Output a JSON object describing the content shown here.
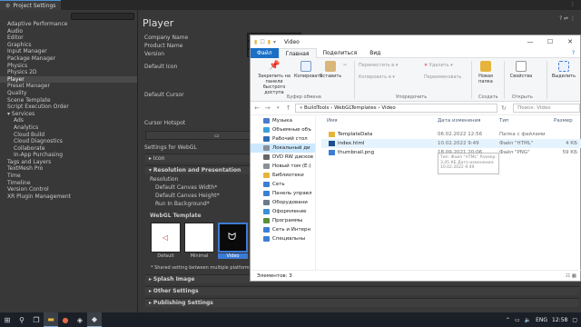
{
  "unity": {
    "window_tab": "Project Settings",
    "categories": [
      {
        "label": "Adaptive Performance"
      },
      {
        "label": "Audio"
      },
      {
        "label": "Editor"
      },
      {
        "label": "Graphics"
      },
      {
        "label": "Input Manager"
      },
      {
        "label": "Package Manager"
      },
      {
        "label": "Physics"
      },
      {
        "label": "Physics 2D"
      },
      {
        "label": "Player",
        "selected": true
      },
      {
        "label": "Preset Manager"
      },
      {
        "label": "Quality"
      },
      {
        "label": "Scene Template"
      },
      {
        "label": "Script Execution Order"
      },
      {
        "label": "▾ Services"
      },
      {
        "label": "Ads",
        "sub": true
      },
      {
        "label": "Analytics",
        "sub": true
      },
      {
        "label": "Cloud Build",
        "sub": true
      },
      {
        "label": "Cloud Diagnostics",
        "sub": true
      },
      {
        "label": "Collaborate",
        "sub": true
      },
      {
        "label": "In-App Purchasing",
        "sub": true
      },
      {
        "label": "Tags and Layers"
      },
      {
        "label": "TextMesh Pro"
      },
      {
        "label": "Time"
      },
      {
        "label": "Timeline"
      },
      {
        "label": "Version Control"
      },
      {
        "label": "XR Plugin Management"
      }
    ],
    "player": {
      "title": "Player",
      "company_name": "Company Name",
      "product_name": "Product Name",
      "version": "Version",
      "default_icon": "Default Icon",
      "default_cursor": "Default Cursor",
      "cursor_hotspot": "Cursor Hotspot",
      "settings_for": "Settings for WebGL",
      "icon_section": "Icon",
      "resolution_section": "Resolution and Presentation",
      "resolution_label": "Resolution",
      "canvas_width": "Default Canvas Width*",
      "canvas_height": "Default Canvas Height*",
      "run_in_background": "Run In Background*",
      "webgl_template": "WebGL Template",
      "templates": [
        {
          "label": "Default",
          "bg": "#ffffff"
        },
        {
          "label": "Minimal",
          "bg": "#ffffff"
        },
        {
          "label": "Video",
          "bg": "#0a0a0a"
        }
      ],
      "shared_note": "* Shared setting between multiple platforms.",
      "splash_section": "Splash Image",
      "other_section": "Other Settings",
      "publishing_section": "Publishing Settings"
    }
  },
  "explorer": {
    "title": "Video",
    "ribbon_tabs": [
      "Файл",
      "Главная",
      "Поделиться",
      "Вид"
    ],
    "ribbon": {
      "pin": "Закрепить на панели быстрого доступа",
      "copy": "Копировать",
      "paste": "Вставить",
      "clipboard_group": "Буфер обмена",
      "move_to": "Переместить в ▾",
      "copy_to": "Копировать в ▾",
      "delete": "Удалить ▾",
      "rename": "Переименовать",
      "organize_group": "Упорядочить",
      "new_folder": "Новая папка",
      "create_group": "Создать",
      "properties": "Свойства",
      "open_group": "Открыть",
      "select": "Выделить"
    },
    "address": "«  BuildTools  ›  WebGLTemplates  ›  Video",
    "search_placeholder": "Поиск: Video",
    "nav_items": [
      {
        "label": "Музыка",
        "color": "#4a7bd0"
      },
      {
        "label": "Объемные объ",
        "color": "#3aa0d8"
      },
      {
        "label": "Рабочий стол",
        "color": "#2d6db3"
      },
      {
        "label": "Локальный ди",
        "color": "#8a8f99",
        "selected": true
      },
      {
        "label": "DVD RW дисков",
        "color": "#666"
      },
      {
        "label": "Новый том (E:)",
        "color": "#8a8f99"
      },
      {
        "label": "Библиотеки",
        "color": "#e6b43c"
      },
      {
        "label": "Сеть",
        "color": "#3b7fd4"
      },
      {
        "label": "Панель управл",
        "color": "#3b7fd4"
      },
      {
        "label": "Оборудовани",
        "color": "#6b7a8c"
      },
      {
        "label": "Оформление",
        "color": "#3b8fd4"
      },
      {
        "label": "Программы",
        "color": "#5a8f3c"
      },
      {
        "label": "Сеть и Интерн",
        "color": "#3b7fd4"
      },
      {
        "label": "Специальны",
        "color": "#3b7fd4"
      }
    ],
    "columns": {
      "name": "Имя",
      "date": "Дата изменения",
      "type": "Тип",
      "size": "Размер"
    },
    "files": [
      {
        "name": "TemplateData",
        "date": "06.02.2022 12:56",
        "type": "Папка с файлами",
        "size": "",
        "icon": "folder"
      },
      {
        "name": "index.html",
        "date": "10.02.2022 9:49",
        "type": "Файл \"HTML\"",
        "size": "4 КБ",
        "icon": "html",
        "selected": true
      },
      {
        "name": "thumbnail.png",
        "date": "18.09.2021 20:06",
        "type": "Файл \"PNG\"",
        "size": "59 КБ",
        "icon": "png"
      }
    ],
    "tooltip": "Тип: Файл \"HTML\"  Размер: 3,45 КБ  Дата изменения: 10.02.2022 9:49",
    "status": "Элементов: 3"
  },
  "taskbar": {
    "language": "ENG",
    "time": "12:58"
  },
  "colors": {
    "accent": "#1a6fc6",
    "unity_bg": "#383838",
    "selection": "#cce8ff"
  }
}
